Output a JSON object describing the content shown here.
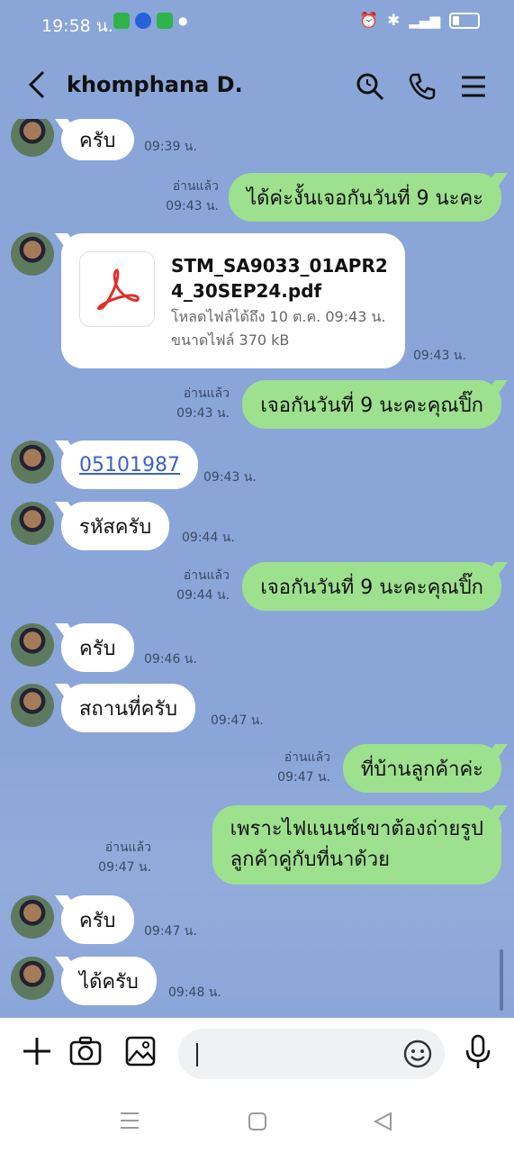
{
  "status": {
    "time": "19:58 น."
  },
  "header": {
    "title": "khomphana D."
  },
  "messages": {
    "m1": {
      "text": "ครับ",
      "time": "09:39 น."
    },
    "m2": {
      "read": "อ่านแล้ว",
      "time": "09:43 น.",
      "text": "ได้ค่ะงั้นเจอกันวันที่ 9 นะคะ"
    },
    "file": {
      "name": "STM_SA9033_01APR24_30SEP24.pdf",
      "download": "โหลดไฟล์ได้ถึง 10 ต.ค. 09:43 น.",
      "size": "ขนาดไฟล์ 370 kB",
      "time": "09:43 น."
    },
    "m3": {
      "read": "อ่านแล้ว",
      "time": "09:43 น.",
      "text": "เจอกันวันที่ 9 นะคะคุณปิ๊ก"
    },
    "m4": {
      "text": "05101987",
      "time": "09:43 น."
    },
    "m5": {
      "text": "รหัสครับ",
      "time": "09:44 น."
    },
    "m6": {
      "read": "อ่านแล้ว",
      "time": "09:44 น.",
      "text": "เจอกันวันที่ 9 นะคะคุณปิ๊ก"
    },
    "m7": {
      "text": "ครับ",
      "time": "09:46 น."
    },
    "m8": {
      "text": "สถานที่ครับ",
      "time": "09:47 น."
    },
    "m9": {
      "read": "อ่านแล้ว",
      "time": "09:47 น.",
      "text": "ที่บ้านลูกค้าค่ะ"
    },
    "m10": {
      "read": "อ่านแล้ว",
      "time": "09:47 น.",
      "line1": "เพราะไฟแนนซ์เขาต้องถ่ายรูป",
      "line2": "ลูกค้าคู่กับที่นาด้วย"
    },
    "m11": {
      "text": "ครับ",
      "time": "09:47 น."
    },
    "m12": {
      "text": "ได้ครับ",
      "time": "09:48 น."
    }
  },
  "colors": {
    "background": "#8aa6d8",
    "outgoing": "#9de08e",
    "incoming": "#ffffff"
  },
  "icons": [
    "back-arrow-icon",
    "search-icon",
    "phone-icon",
    "menu-icon",
    "plus-icon",
    "camera-icon",
    "image-icon",
    "emoji-icon",
    "microphone-icon",
    "pdf-icon"
  ]
}
